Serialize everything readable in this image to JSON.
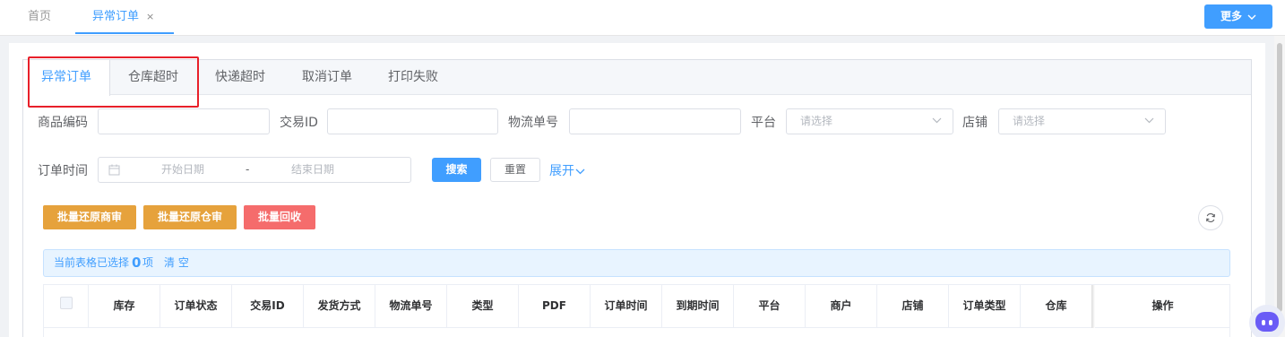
{
  "top_tabs": [
    {
      "label": "首页"
    },
    {
      "label": "异常订单",
      "close": "×"
    }
  ],
  "more_button": "更多",
  "panel_tabs": [
    {
      "label": "异常订单"
    },
    {
      "label": "仓库超时"
    },
    {
      "label": "快递超时"
    },
    {
      "label": "取消订单"
    },
    {
      "label": "打印失败"
    }
  ],
  "filters": {
    "product_code": {
      "label": "商品编码",
      "value": ""
    },
    "trade_id": {
      "label": "交易ID",
      "value": ""
    },
    "tracking_no": {
      "label": "物流单号",
      "value": ""
    },
    "platform": {
      "label": "平台",
      "placeholder": "请选择"
    },
    "store": {
      "label": "店铺",
      "placeholder": "请选择"
    },
    "order_time": {
      "label": "订单时间",
      "start_placeholder": "开始日期",
      "separator": "-",
      "end_placeholder": "结束日期"
    }
  },
  "buttons": {
    "search": "搜索",
    "reset": "重置",
    "expand": "展开"
  },
  "batch_buttons": [
    {
      "label": "批量还原商审"
    },
    {
      "label": "批量还原仓审"
    },
    {
      "label": "批量回收"
    }
  ],
  "selection": {
    "prefix": "当前表格已选择",
    "count": "0",
    "suffix": "项",
    "clear": "清 空"
  },
  "table": {
    "columns": [
      "库存",
      "订单状态",
      "交易ID",
      "发货方式",
      "物流单号",
      "类型",
      "PDF",
      "订单时间",
      "到期时间",
      "平台",
      "商户",
      "店铺",
      "订单类型",
      "仓库",
      "操作"
    ]
  },
  "colors": {
    "primary": "#409eff",
    "warning": "#e6a23c",
    "danger": "#f56c6c",
    "highlight": "#e8202a"
  }
}
